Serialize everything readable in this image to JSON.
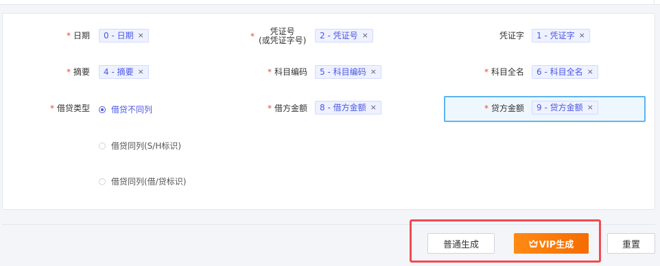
{
  "fields": {
    "date": {
      "label": "日期",
      "tag": "0 - 日期"
    },
    "voucher_no": {
      "label_line1": "凭证号",
      "label_line2": "(或凭证字号)",
      "tag": "2 - 凭证号"
    },
    "voucher_word": {
      "label": "凭证字",
      "tag": "1 - 凭证字"
    },
    "summary": {
      "label": "摘要",
      "tag": "4 - 摘要"
    },
    "account_code": {
      "label": "科目编码",
      "tag": "5 - 科目编码"
    },
    "account_fullname": {
      "label": "科目全名",
      "tag": "6 - 科目全名"
    },
    "dc_type": {
      "label": "借贷类型"
    },
    "debit_amount": {
      "label": "借方金额",
      "tag": "8 - 借方金额"
    },
    "credit_amount": {
      "label": "贷方金额",
      "tag": "9 - 贷方金额"
    }
  },
  "dc_type_options": [
    {
      "label": "借贷不同列",
      "checked": true
    },
    {
      "label": "借贷同列(S/H标识)",
      "checked": false
    },
    {
      "label": "借贷同列(借/贷标识)",
      "checked": false
    }
  ],
  "required_mark": "*",
  "remove_glyph": "×",
  "buttons": {
    "normal_generate": "普通生成",
    "vip_generate": "VIP生成",
    "reset": "重置"
  },
  "colors": {
    "accent": "#4a57e0",
    "required": "#e2483d",
    "vip_orange": "#f57c0a",
    "highlight_border": "#5cb3ef",
    "callout_red": "#ef4a4f"
  },
  "icons": {
    "vip": "crown-icon",
    "remove": "close-icon"
  }
}
